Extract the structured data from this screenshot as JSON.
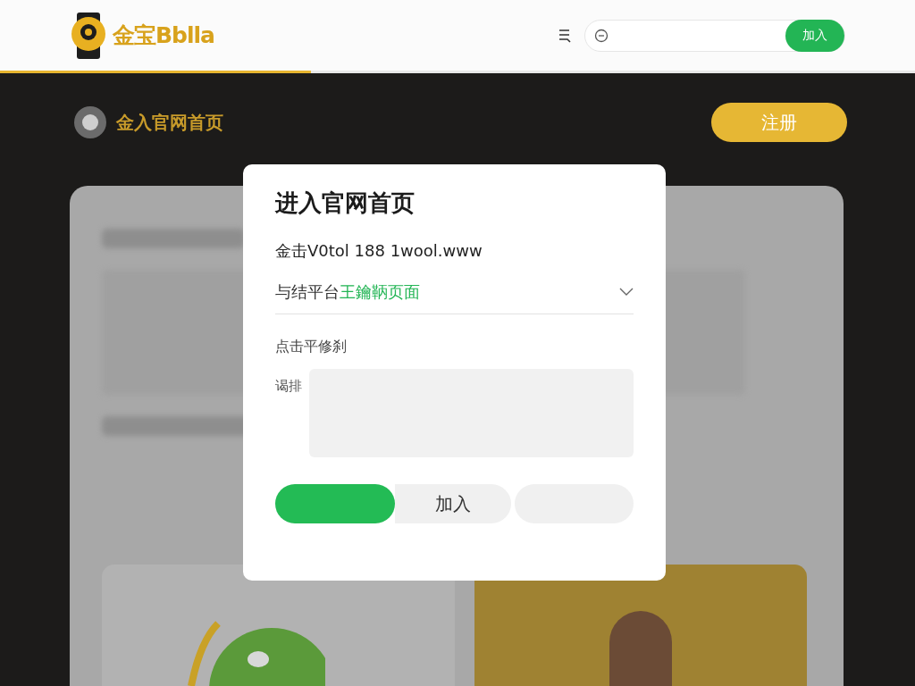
{
  "header": {
    "logo": "金宝Bblla",
    "join_button": "加入",
    "progress": {
      "level": 0.34
    }
  },
  "nav": {
    "home_link": "金入官网首页",
    "register_button": "注册"
  },
  "dialog": {
    "title": "进入官网首页",
    "subtitle": "金击V0tol 188 1wool.www",
    "select": {
      "prefix": "与结平台",
      "value": "王鑰鞆页面",
      "expanded": false
    },
    "section_label": "点击平修刹",
    "field_label": "谒排",
    "buttons": [
      {
        "kind": "primary"
      },
      {
        "kind": "secondary",
        "label": "加入"
      },
      {
        "kind": "blank"
      }
    ]
  }
}
